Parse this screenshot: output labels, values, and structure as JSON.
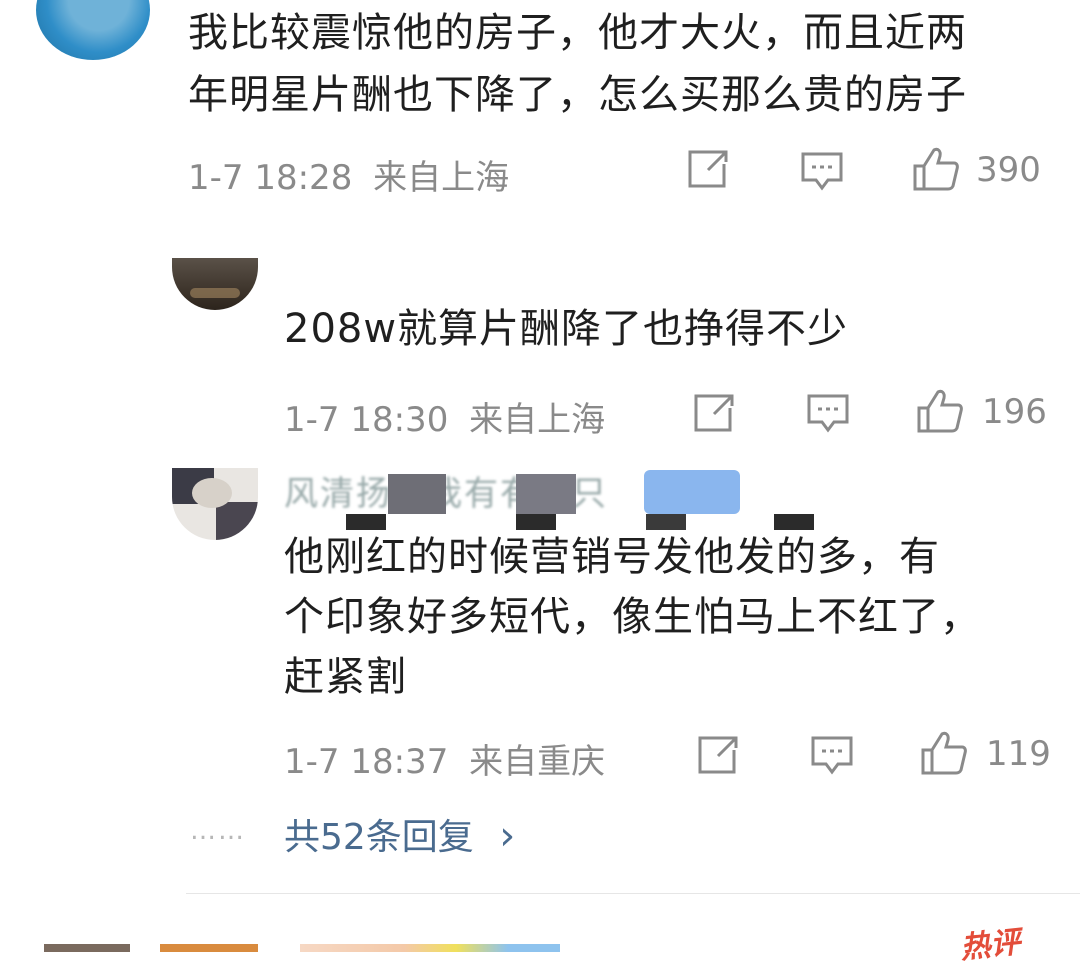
{
  "comments": [
    {
      "text_line1": "我比较震惊他的房子，他才大火，而且近两",
      "text_line2": "年明星片酬也下降了，怎么买那么贵的房子",
      "time": "1-7 18:28",
      "location": "来自上海",
      "likes": "390"
    },
    {
      "text_line1": "208w就算片酬降了也挣得不少",
      "time": "1-7 18:30",
      "location": "来自上海",
      "likes": "196"
    },
    {
      "username": "风清扬有我有有一只",
      "text_line1": "他刚红的时候营销号发他发的多，有",
      "text_line2": "个印象好多短代，像生怕马上不红了，",
      "text_line3": "赶紧割",
      "time": "1-7 18:37",
      "location": "来自重庆",
      "likes": "119"
    }
  ],
  "replies_link": "共52条回复",
  "replies_chevron": "›",
  "replies_dots": "……",
  "hot_badge": "热评",
  "icons": {
    "share": "share-icon",
    "comment": "comment-icon",
    "like": "like-icon",
    "chevron": "chevron-right-icon"
  },
  "colors": {
    "link": "#4a6b8f",
    "meta": "#8a8a8a",
    "text": "#1f1f1f",
    "hot": "#e34d3a"
  }
}
